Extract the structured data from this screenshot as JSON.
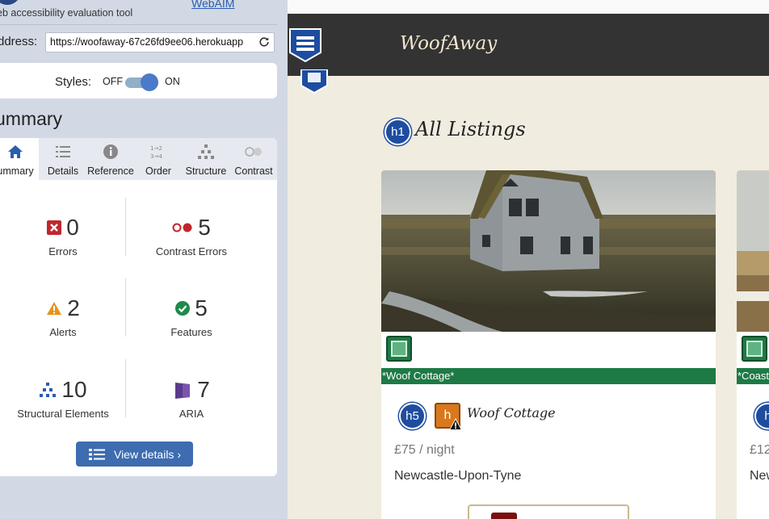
{
  "wave": {
    "tagline": "eb accessibility evaluation tool",
    "link": "WebAIM",
    "address_label": "ddress:",
    "address_value": "https://woofaway-67c26fd9ee06.herokuapp",
    "styles_label": "Styles:",
    "styles_off": "OFF",
    "styles_on": "ON",
    "styles_enabled": true,
    "summary_title": "ummary",
    "tabs": [
      {
        "label": "ummary",
        "icon": "home-icon",
        "active": true
      },
      {
        "label": "Details",
        "icon": "list-icon",
        "active": false
      },
      {
        "label": "Reference",
        "icon": "info-icon",
        "active": false
      },
      {
        "label": "Order",
        "icon": "order-icon",
        "active": false
      },
      {
        "label": "Structure",
        "icon": "structure-icon",
        "active": false
      },
      {
        "label": "Contrast",
        "icon": "contrast-icon",
        "active": false
      }
    ],
    "stats": {
      "errors": {
        "value": "0",
        "label": "Errors",
        "icon": "error-icon",
        "color": "#c0272d"
      },
      "contrast_errors": {
        "value": "5",
        "label": "Contrast Errors",
        "icon": "contrast-error-icon",
        "color": "#c0272d"
      },
      "alerts": {
        "value": "2",
        "label": "Alerts",
        "icon": "alert-icon",
        "color": "#e5941d"
      },
      "features": {
        "value": "5",
        "label": "Features",
        "icon": "feature-icon",
        "color": "#1e8a4a"
      },
      "structural": {
        "value": "10",
        "label": "Structural Elements",
        "icon": "structure-icon",
        "color": "#2a5db0"
      },
      "aria": {
        "value": "7",
        "label": "ARIA",
        "icon": "aria-icon",
        "color": "#5a3a8a"
      }
    },
    "view_details": "View details ›"
  },
  "site": {
    "brand": "WoofAway",
    "h1_badge": "h1",
    "heading": "All Listings",
    "accent": "#333333",
    "cards": [
      {
        "alt_text": "*Woof Cottage*",
        "h5_badge": "h5",
        "alert_badge": "h",
        "title": "Woof Cottage",
        "price": "£75 / night",
        "location": "Newcastle-Upon-Tyne"
      },
      {
        "alt_text": "*Coast",
        "h5_badge": "h",
        "price": "£12",
        "location": "New"
      }
    ]
  }
}
